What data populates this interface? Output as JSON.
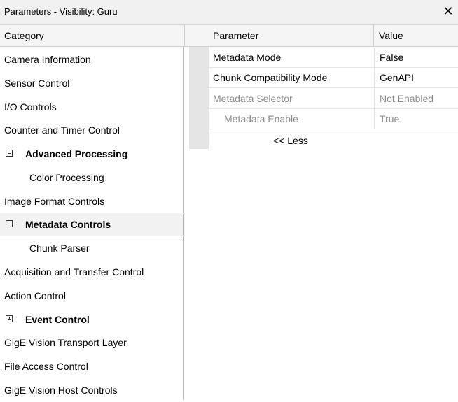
{
  "window": {
    "title": "Parameters - Visibility: Guru",
    "close_glyph": "✕"
  },
  "headers": {
    "category": "Category",
    "parameter": "Parameter",
    "value": "Value"
  },
  "categories": [
    {
      "label": "Camera Information"
    },
    {
      "label": "Sensor Control"
    },
    {
      "label": "I/O Controls"
    },
    {
      "label": "Counter and Timer Control"
    },
    {
      "label": "Advanced Processing",
      "expander": "minus",
      "expanded": true
    },
    {
      "label": "Color Processing"
    },
    {
      "label": "Image Format Controls"
    },
    {
      "label": "Metadata Controls",
      "expander": "minus",
      "expanded": true,
      "selected": true
    },
    {
      "label": "Chunk Parser"
    },
    {
      "label": "Acquisition and Transfer Control"
    },
    {
      "label": "Action Control"
    },
    {
      "label": "Event Control",
      "expander": "plus",
      "expanded": false
    },
    {
      "label": "GigE Vision Transport Layer"
    },
    {
      "label": "File Access Control"
    },
    {
      "label": "GigE Vision Host Controls"
    }
  ],
  "parameters": [
    {
      "name": "Metadata Mode",
      "value": "False",
      "enabled": true
    },
    {
      "name": "Chunk Compatibility Mode",
      "value": "GenAPI",
      "enabled": true
    },
    {
      "name": "Metadata Selector",
      "value": "Not Enabled",
      "enabled": false
    },
    {
      "name": "Metadata Enable",
      "value": "True",
      "enabled": false
    }
  ],
  "less_link": "<< Less",
  "colors": {
    "selected_bg": "#f2f2f2",
    "disabled_text": "#8c8c8c",
    "gutter": "#e5e5e5"
  }
}
